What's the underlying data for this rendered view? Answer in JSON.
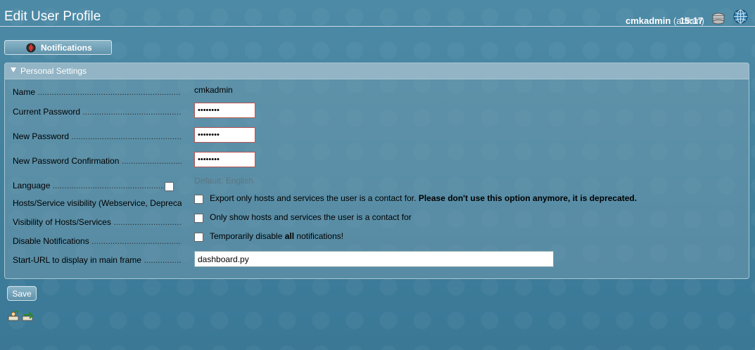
{
  "header": {
    "title": "Edit User Profile",
    "username": "cmkadmin",
    "role": "(admin)",
    "time": "15:17"
  },
  "notifications_button": {
    "label": "Notifications"
  },
  "section": {
    "title": "Personal Settings",
    "fields": {
      "name": {
        "label": "Name",
        "value": "cmkadmin"
      },
      "current_password": {
        "label": "Current Password",
        "value": "••••••••"
      },
      "new_password": {
        "label": "New Password",
        "value": "••••••••"
      },
      "new_password_confirmation": {
        "label": "New Password Confirmation",
        "value": "••••••••"
      },
      "language": {
        "label": "Language",
        "default_text": "Default: English"
      },
      "hosts_service_visibility": {
        "label": "Hosts/Service visibility (Webservice, Deprecated)",
        "checkbox_text": "Export only hosts and services the user is a contact for.",
        "checkbox_text_bold": "Please don't use this option anymore, it is deprecated."
      },
      "visibility_hosts_services": {
        "label": "Visibility of Hosts/Services",
        "checkbox_text": "Only show hosts and services the user is a contact for"
      },
      "disable_notifications": {
        "label": "Disable Notifications",
        "text_before": "Temporarily disable ",
        "text_bold": "all",
        "text_after": " notifications!"
      },
      "start_url": {
        "label": "Start-URL to display in main frame",
        "value": "dashboard.py"
      }
    }
  },
  "save_button": {
    "label": "Save"
  },
  "colors": {
    "background": "#4d8aa6",
    "password_border": "#bb5555"
  },
  "icons": [
    "notification-icon",
    "database-icon",
    "globe-icon",
    "user-import-icon",
    "user-sync-icon"
  ]
}
